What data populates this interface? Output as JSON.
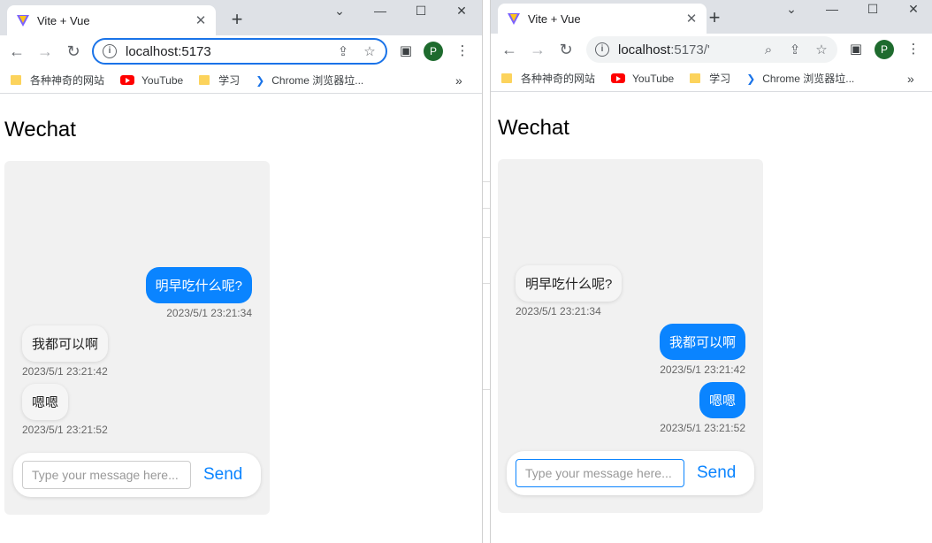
{
  "left_window": {
    "tab_title": "Vite + Vue",
    "url": "localhost:5173",
    "url_rest": "",
    "profile_initial": "P",
    "bookmarks": [
      "各种神奇的网站",
      "YouTube",
      "学习",
      "Chrome 浏览器垃..."
    ],
    "app_title": "Wechat",
    "messages": [
      {
        "text": "明早吃什么呢?",
        "time": "2023/5/1 23:21:34",
        "side": "out"
      },
      {
        "text": "我都可以啊",
        "time": "2023/5/1 23:21:42",
        "side": "in"
      },
      {
        "text": "嗯嗯",
        "time": "2023/5/1 23:21:52",
        "side": "in"
      }
    ],
    "input_placeholder": "Type your message here...",
    "send_label": "Send"
  },
  "right_window": {
    "tab_title": "Vite + Vue",
    "url": "localhost",
    "url_rest": ":5173/'",
    "profile_initial": "P",
    "bookmarks": [
      "各种神奇的网站",
      "YouTube",
      "学习",
      "Chrome 浏览器垃..."
    ],
    "app_title": "Wechat",
    "messages": [
      {
        "text": "明早吃什么呢?",
        "time": "2023/5/1 23:21:34",
        "side": "in"
      },
      {
        "text": "我都可以啊",
        "time": "2023/5/1 23:21:42",
        "side": "out"
      },
      {
        "text": "嗯嗯",
        "time": "2023/5/1 23:21:52",
        "side": "out"
      }
    ],
    "input_placeholder": "Type your message here...",
    "send_label": "Send"
  },
  "colors": {
    "accent": "#0a84ff",
    "omnibox_focus": "#1a73e8",
    "chat_bg": "#f1f1f1"
  },
  "icons": [
    "vite-logo-icon",
    "close-icon",
    "plus-icon",
    "minimize-icon",
    "maximize-icon",
    "chevron-down-icon",
    "back-arrow-icon",
    "forward-arrow-icon",
    "reload-icon",
    "info-icon",
    "share-icon",
    "star-icon",
    "search-icon",
    "sidebar-icon",
    "menu-dots-icon",
    "folder-icon",
    "youtube-icon",
    "chrome-bookmark-icon",
    "more-chevron-icon"
  ]
}
